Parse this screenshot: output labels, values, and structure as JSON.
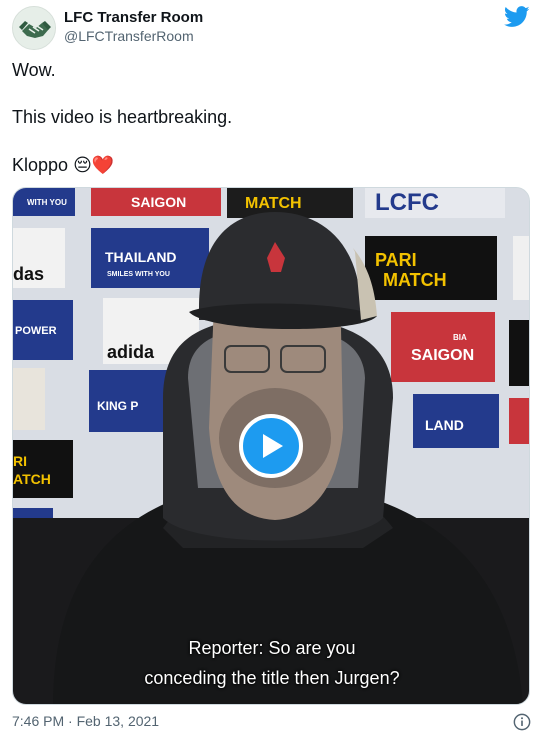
{
  "author": {
    "display_name": "LFC Transfer Room",
    "handle": "@LFCTransferRoom",
    "avatar_icon": "handshake-logo"
  },
  "brand_icon": "twitter-bird-icon",
  "tweet": {
    "line1": "Wow.",
    "line2": "This video is heartbreaking.",
    "line3_text": "Kloppo",
    "line3_emoji1": "😔",
    "line3_emoji2": "❤️"
  },
  "video": {
    "backdrop_logos": [
      "SAIGON",
      "MATCH",
      "LCFC",
      "THAILAND",
      "SMILES WITH YOU",
      "das",
      "PARI",
      "MATCH",
      "POWER",
      "adida",
      "BIA",
      "SAIGON",
      "KING P",
      "LAND",
      "RI",
      "ATCH",
      "WITH YOU"
    ],
    "subtitle_line1": "Reporter: So are you",
    "subtitle_line2": "conceding the title then Jurgen?",
    "play_icon": "play-icon"
  },
  "timestamp": "7:46 PM · Feb 13, 2021",
  "info_icon": "info-icon",
  "colors": {
    "accent": "#1d9bf0",
    "text": "#0f1419",
    "secondary": "#536471"
  }
}
